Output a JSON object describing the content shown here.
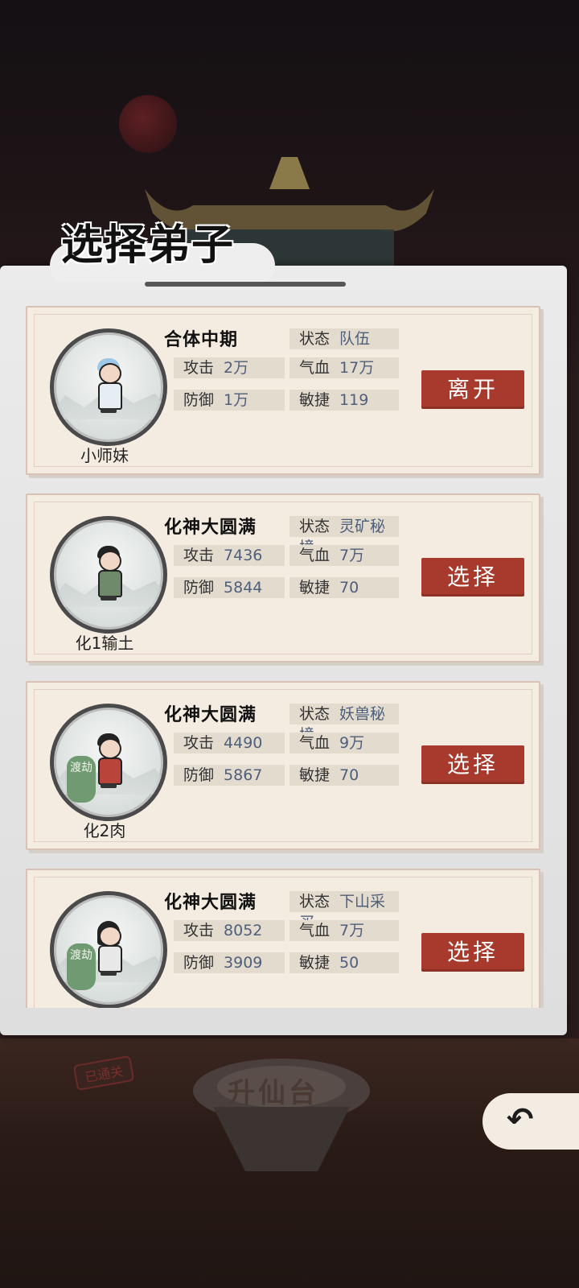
{
  "title": "选择弟子",
  "colors": {
    "button_red": "#a73a2c",
    "panel_bg": "#ebebeb",
    "card_bg": "#f4ece1",
    "dujie_green": "#6f9a72",
    "stat_value_blue": "#4e5f7a"
  },
  "disciples": [
    {
      "name": "小师妹",
      "realm": "合体中期",
      "state_label": "状态",
      "state": "队伍",
      "atk_label": "攻击",
      "atk": "2万",
      "hp_label": "气血",
      "hp": "17万",
      "def_label": "防御",
      "def": "1万",
      "agi_label": "敏捷",
      "agi": "119",
      "action": "离开",
      "dujie": ""
    },
    {
      "name": "化1输土",
      "realm": "化神大圆满",
      "state_label": "状态",
      "state": "灵矿秘境",
      "atk_label": "攻击",
      "atk": "7436",
      "hp_label": "气血",
      "hp": "7万",
      "def_label": "防御",
      "def": "5844",
      "agi_label": "敏捷",
      "agi": "70",
      "action": "选择",
      "dujie": ""
    },
    {
      "name": "化2肉",
      "realm": "化神大圆满",
      "state_label": "状态",
      "state": "妖兽秘境",
      "atk_label": "攻击",
      "atk": "4490",
      "hp_label": "气血",
      "hp": "9万",
      "def_label": "防御",
      "def": "5867",
      "agi_label": "敏捷",
      "agi": "70",
      "action": "选择",
      "dujie": "渡劫"
    },
    {
      "name": "",
      "realm": "化神大圆满",
      "state_label": "状态",
      "state": "下山采买",
      "atk_label": "攻击",
      "atk": "8052",
      "hp_label": "气血",
      "hp": "7万",
      "def_label": "防御",
      "def": "3909",
      "agi_label": "敏捷",
      "agi": "50",
      "action": "选择",
      "dujie": "渡劫"
    }
  ],
  "background": {
    "stage_label": "升仙台",
    "passed_tag": "已通关"
  },
  "back_icon": "back-arrow-icon"
}
